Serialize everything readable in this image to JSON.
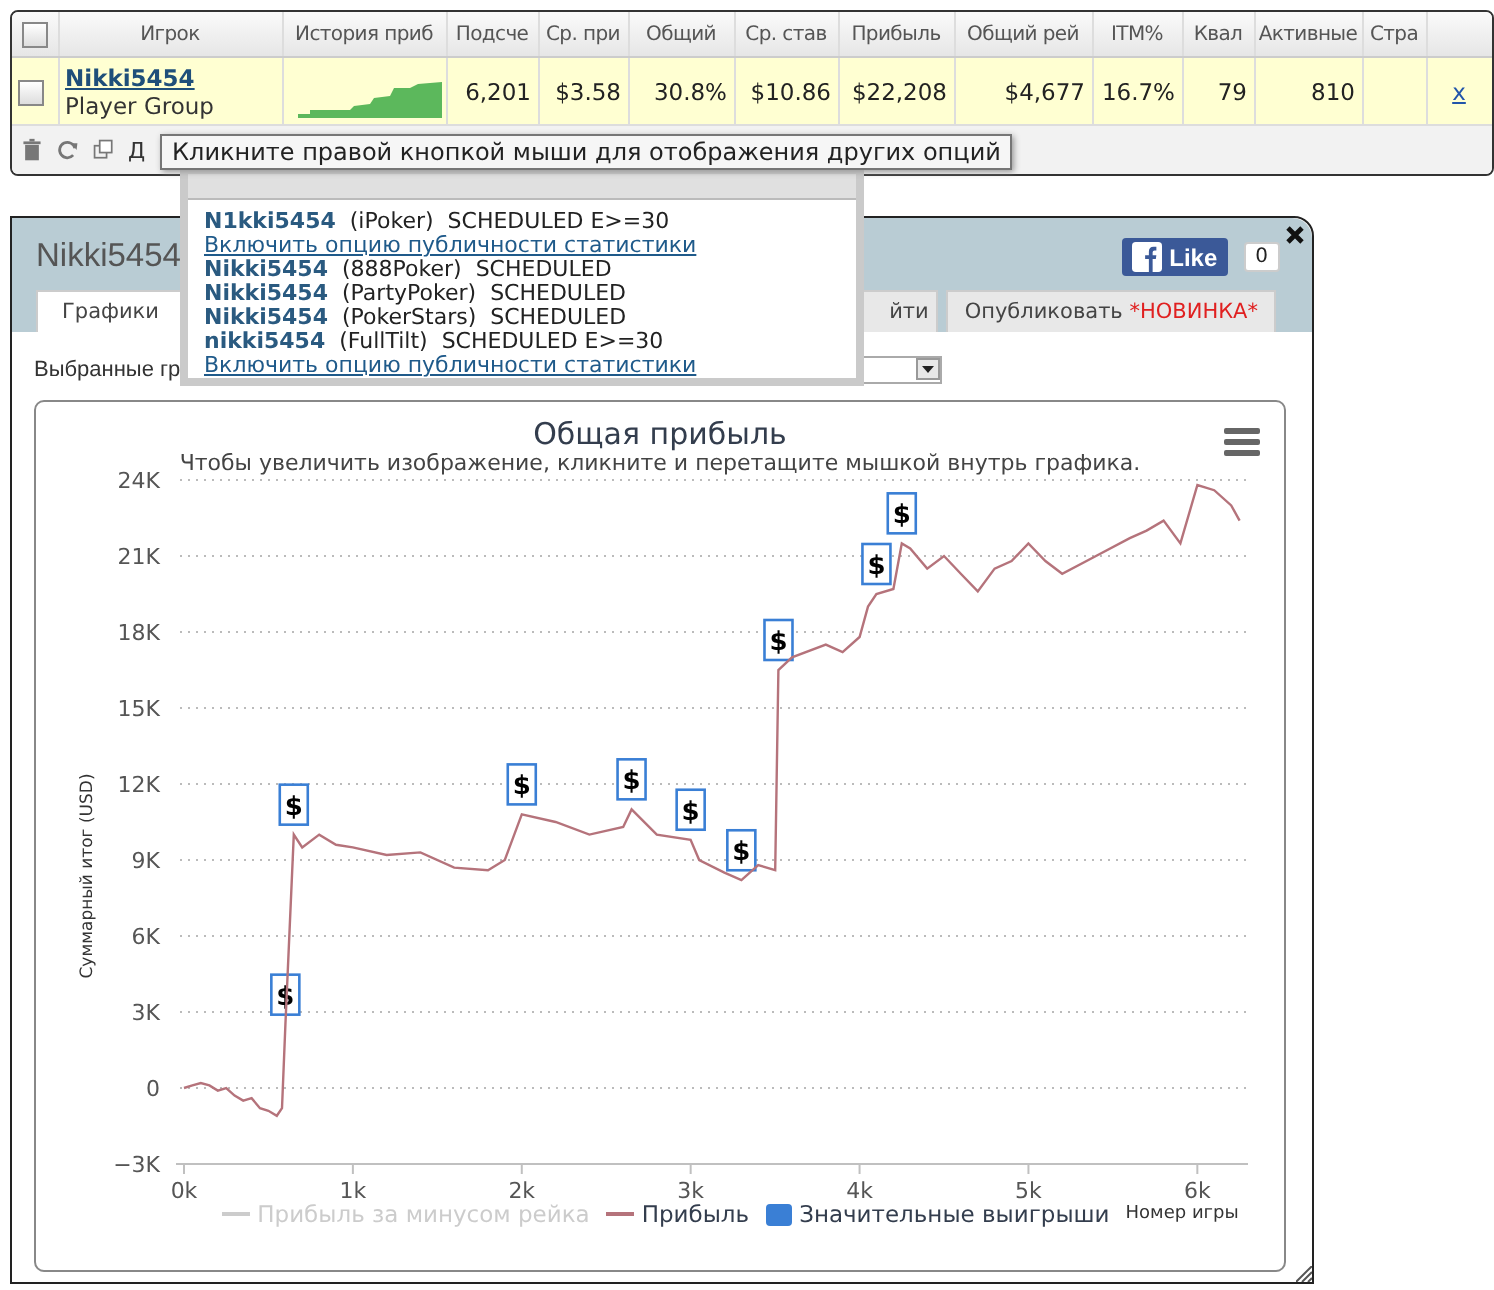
{
  "grid": {
    "select_all_checked": false,
    "columns": [
      "Игрок",
      "История приб",
      "Подсче",
      "Ср. при",
      "Общий",
      "Ср. став",
      "Прибыль",
      "Общий рей",
      "ITM%",
      "Квал",
      "Активные",
      "Стра"
    ],
    "rows": [
      {
        "checked": false,
        "cells": [
          {
            "kind": "player",
            "text": "Nikki5454",
            "sub": "Player Group"
          },
          {
            "kind": "sparkline"
          },
          {
            "kind": "text",
            "text": "6,201"
          },
          {
            "kind": "text",
            "text": "$3.58"
          },
          {
            "kind": "text",
            "text": "30.8%"
          },
          {
            "kind": "text",
            "text": "$10.86"
          },
          {
            "kind": "text",
            "text": "$22,208"
          },
          {
            "kind": "text",
            "text": "$4,677"
          },
          {
            "kind": "text",
            "text": "16.7%"
          },
          {
            "kind": "text",
            "text": "79"
          },
          {
            "kind": "text",
            "text": "810"
          },
          {
            "kind": "empty"
          }
        ],
        "remove": "x"
      }
    ],
    "toolbar_label": "Д"
  },
  "tooltip": "Кликните правой кнопкой мыши для отображения других опций",
  "popup": {
    "entries": [
      {
        "name": "N1kki5454",
        "site": "(iPoker)",
        "status": "SCHEDULED E>=30",
        "link": "Включить опцию публичности статистики"
      },
      {
        "name": "Nikki5454",
        "site": "(888Poker)",
        "status": "SCHEDULED"
      },
      {
        "name": "Nikki5454",
        "site": "(PartyPoker)",
        "status": "SCHEDULED"
      },
      {
        "name": "Nikki5454",
        "site": "(PokerStars)",
        "status": "SCHEDULED"
      },
      {
        "name": "nikki5454",
        "site": "(FullTilt)",
        "status": "SCHEDULED E>=30",
        "link": "Включить опцию публичности статистики"
      }
    ]
  },
  "dialog": {
    "title": "Nikki5454",
    "like": {
      "label": "Like",
      "count": "0"
    },
    "tabs": [
      {
        "label": "Графики",
        "selected": true
      },
      {
        "label": "йти",
        "selected": false
      },
      {
        "label": "Опубликовать",
        "badge": "*НОВИНКА*",
        "selected": false
      }
    ],
    "filter_label": "Выбранные гр",
    "chart": {
      "subtitle": "Чтобы увеличить изображение, кликните и перетащите мышкой внутрь графика.",
      "legend": [
        {
          "label": "Прибыль за минусом рейка",
          "kind": "line",
          "color": "#cccccc",
          "visible": false
        },
        {
          "label": "Значительные выигрыши",
          "kind": "square",
          "color": "#3a7fd5",
          "visible": true
        }
      ],
      "flags": [
        {
          "text": "$"
        },
        {
          "text": "$"
        },
        {
          "text": "$"
        },
        {
          "text": "$"
        },
        {
          "text": "$"
        },
        {
          "text": "$"
        },
        {
          "text": "$"
        },
        {
          "text": "$"
        },
        {
          "text": "$"
        }
      ],
      "chart_data": {
        "type": "line",
        "title": "Общая прибыль",
        "xlabel": "Номер игры",
        "ylabel": "Суммарный итог (USD)",
        "xlim": [
          0,
          6.3
        ],
        "ylim": [
          -3,
          24
        ],
        "grid": true,
        "x": [
          0,
          0.05,
          0.1,
          0.15,
          0.2,
          0.25,
          0.3,
          0.35,
          0.4,
          0.45,
          0.5,
          0.55,
          0.58,
          0.6,
          0.65,
          0.7,
          0.8,
          0.9,
          1.0,
          1.2,
          1.4,
          1.6,
          1.8,
          1.9,
          2.0,
          2.2,
          2.4,
          2.6,
          2.65,
          2.8,
          3.0,
          3.05,
          3.2,
          3.3,
          3.4,
          3.5,
          3.52,
          3.6,
          3.8,
          3.9,
          4.0,
          4.05,
          4.1,
          4.2,
          4.25,
          4.3,
          4.4,
          4.5,
          4.6,
          4.7,
          4.8,
          4.9,
          5.0,
          5.1,
          5.2,
          5.4,
          5.6,
          5.7,
          5.8,
          5.9,
          6.0,
          6.1,
          6.2,
          6.25
        ],
        "series": [
          {
            "name": "Прибыль",
            "color": "#b5737b",
            "values": [
              0,
              0.1,
              0.2,
              0.1,
              -0.1,
              0,
              -0.3,
              -0.5,
              -0.4,
              -0.8,
              -0.9,
              -1.1,
              -0.8,
              2.5,
              10.0,
              9.5,
              10.0,
              9.6,
              9.5,
              9.2,
              9.3,
              8.7,
              8.6,
              9.0,
              10.8,
              10.5,
              10.0,
              10.3,
              11.0,
              10.0,
              9.8,
              9.0,
              8.5,
              8.2,
              8.8,
              8.6,
              16.5,
              17.0,
              17.5,
              17.2,
              17.8,
              19.0,
              19.5,
              19.7,
              21.5,
              21.3,
              20.5,
              21.0,
              20.3,
              19.6,
              20.5,
              20.8,
              21.5,
              20.8,
              20.3,
              21.0,
              21.7,
              22.0,
              22.4,
              21.5,
              23.8,
              23.6,
              23.0,
              22.4
            ]
          }
        ],
        "xticks": [
          {
            "value": 0,
            "label": "0k"
          },
          {
            "value": 1,
            "label": "1k"
          },
          {
            "value": 2,
            "label": "2k"
          },
          {
            "value": 3,
            "label": "3k"
          },
          {
            "value": 4,
            "label": "4k"
          },
          {
            "value": 5,
            "label": "5k"
          },
          {
            "value": 6,
            "label": "6k"
          }
        ],
        "yticks": [
          {
            "value": -3,
            "label": "−3K"
          },
          {
            "value": 0,
            "label": "0"
          },
          {
            "value": 3,
            "label": "3K"
          },
          {
            "value": 6,
            "label": "6K"
          },
          {
            "value": 9,
            "label": "9K"
          },
          {
            "value": 12,
            "label": "12K"
          },
          {
            "value": 15,
            "label": "15K"
          },
          {
            "value": 18,
            "label": "18K"
          },
          {
            "value": 21,
            "label": "21K"
          },
          {
            "value": 24,
            "label": "24K"
          }
        ]
      }
    }
  }
}
